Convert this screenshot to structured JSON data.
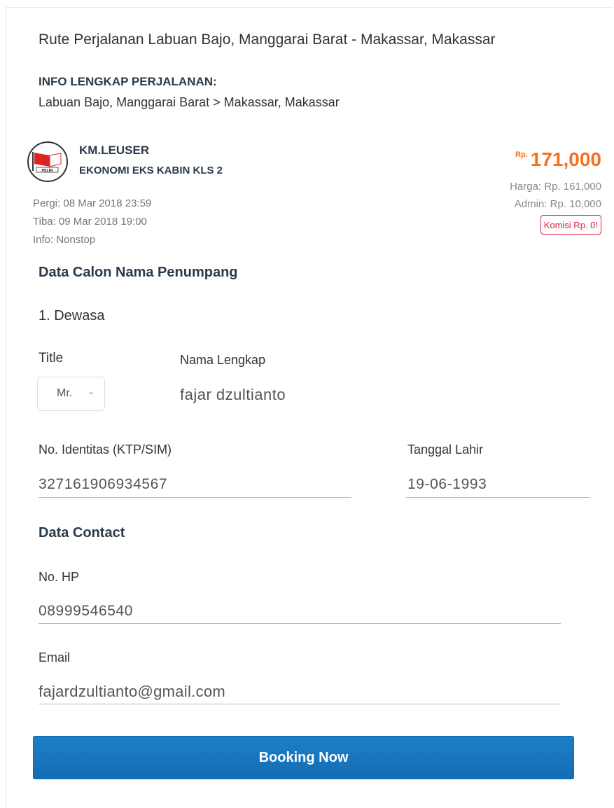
{
  "route_header": "Rute Perjalanan Labuan Bajo, Manggarai Barat - Makassar, Makassar",
  "trip_info": {
    "title": "INFO LENGKAP PERJALANAN:",
    "route": "Labuan Bajo, Manggarai Barat > Makassar, Makassar"
  },
  "ship": {
    "logo_text": "PELNI",
    "name": "KM.LEUSER",
    "class": "EKONOMI EKS KABIN KLS 2",
    "departure": "Pergi: 08 Mar 2018 23:59",
    "arrival": "Tiba: 09 Mar 2018 19:00",
    "info": "Info: Nonstop"
  },
  "price": {
    "currency": "Rp.",
    "total": "171,000",
    "harga": "Harga: Rp. 161,000",
    "admin": "Admin: Rp. 10,000",
    "komisi": "Komisi Rp. 0!"
  },
  "passenger": {
    "section_title": "Data Calon Nama Penumpang",
    "type": "1. Dewasa",
    "title_label": "Title",
    "title_value": "Mr.",
    "name_label": "Nama Lengkap",
    "name_value": "fajar dzultianto",
    "id_label": "No. Identitas (KTP/SIM)",
    "id_value": "327161906934567",
    "dob_label": "Tanggal Lahir",
    "dob_value": "19-06-1993"
  },
  "contact": {
    "section_title": "Data Contact",
    "phone_label": "No. HP",
    "phone_value": "08999546540",
    "email_label": "Email",
    "email_value": "fajardzultianto@gmail.com"
  },
  "booking_button": "Booking Now",
  "colors": {
    "accent": "#f5711e",
    "button": "#1a76bf",
    "warning": "#d9233b"
  }
}
